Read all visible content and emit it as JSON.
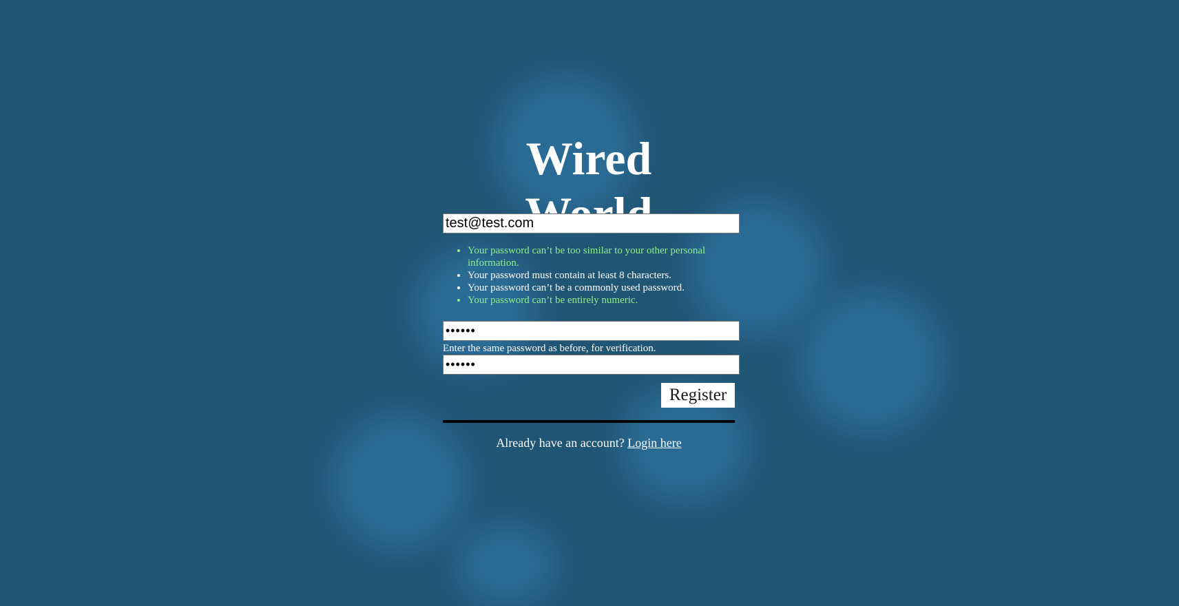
{
  "app": {
    "title": "Wired World"
  },
  "form": {
    "email": {
      "value": "test@test.com"
    },
    "password_rules": [
      {
        "text": "Your password can’t be too similar to your other personal information.",
        "status": "met"
      },
      {
        "text": "Your password must contain at least 8 characters.",
        "status": "unmet"
      },
      {
        "text": "Your password can’t be a commonly used password.",
        "status": "unmet"
      },
      {
        "text": "Your password can’t be entirely numeric.",
        "status": "met"
      }
    ],
    "password": {
      "value": "••••••"
    },
    "confirm_help": "Enter the same password as before, for verification.",
    "password_confirm": {
      "value": "••••••"
    },
    "register_label": "Register"
  },
  "footer": {
    "prompt": "Already have an account?",
    "login_link": "Login here"
  },
  "colors": {
    "background": "#215574",
    "blob": "#2c6f9b",
    "rule_met": "#90ee90",
    "rule_unmet": "#ffffff"
  }
}
